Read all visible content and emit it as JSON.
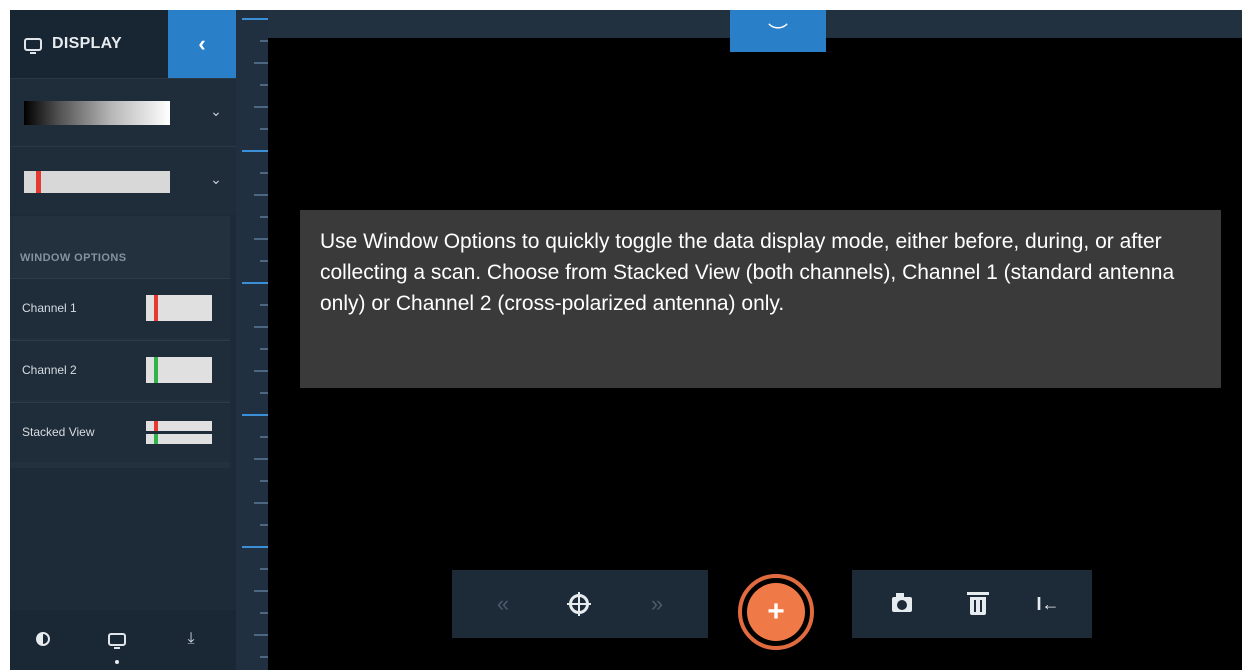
{
  "sidebar": {
    "title": "DISPLAY",
    "icons": {
      "display": "monitor-icon",
      "collapse": "chevron-left-icon",
      "dropdown": "chevron-down-icon"
    },
    "collapse_glyph": "‹",
    "dropdown_glyph": "⌄",
    "window_options": {
      "title": "WINDOW OPTIONS",
      "items": [
        {
          "label": "Channel 1",
          "marker_color": "#e53a2f"
        },
        {
          "label": "Channel 2",
          "marker_color": "#2fb34a"
        },
        {
          "label": "Stacked View",
          "marker_colors": [
            "#e53a2f",
            "#2fb34a"
          ]
        }
      ]
    },
    "bottom_icons": [
      "contrast-icon",
      "display-icon",
      "export-icon"
    ],
    "export_glyph": "⤓"
  },
  "top_handle": {
    "icon": "chevron-down-icon",
    "glyph": "︶"
  },
  "tooltip": {
    "text": "Use Window Options to quickly toggle the data display mode, either before, during, or after collecting a scan. Choose from Stacked View (both channels), Channel 1 (standard antenna only) or Channel 2 (cross-polarized antenna) only."
  },
  "controls": {
    "nav": {
      "rewind_glyph": "«",
      "forward_glyph": "»",
      "icons": [
        "rewind-icon",
        "crosshair-icon",
        "fast-forward-icon"
      ]
    },
    "add_glyph": "+",
    "tools": {
      "icons": [
        "camera-icon",
        "trash-icon",
        "jump-to-start-icon"
      ],
      "jump_glyph": "I←"
    }
  },
  "colors": {
    "accent_blue": "#2a7fc9",
    "add_orange": "#f07a47",
    "panel_dark": "#1d2a37",
    "tooltip_bg": "#3a3a3a"
  }
}
